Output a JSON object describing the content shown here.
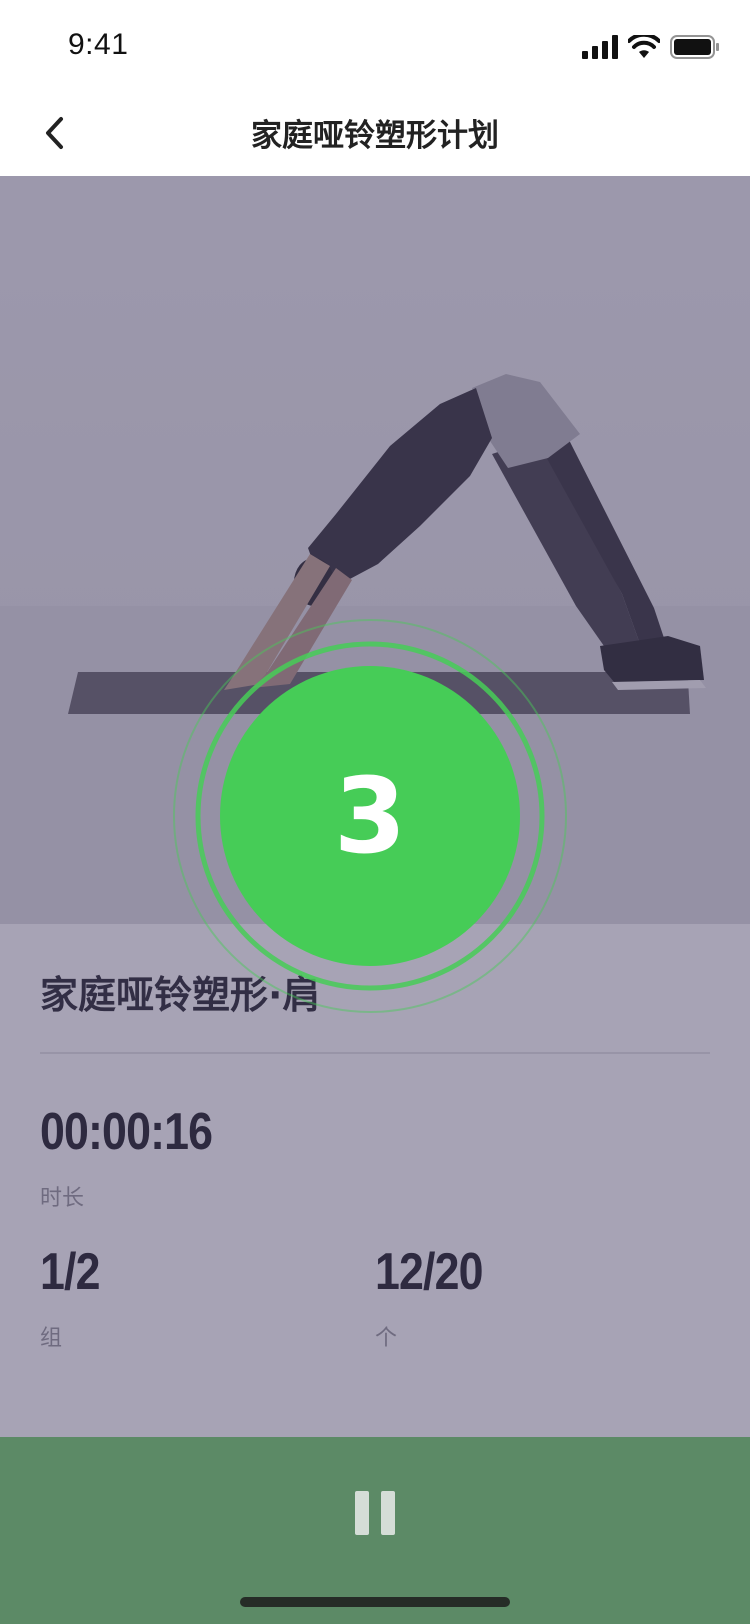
{
  "status_bar": {
    "time": "9:41"
  },
  "nav": {
    "title": "家庭哑铃塑形计划",
    "back_icon": "chevron-left-icon"
  },
  "workout": {
    "exercise_name": "家庭哑铃塑形·肩",
    "duration": {
      "value": "00:00:16",
      "label": "时长"
    },
    "sets": {
      "value": "1/2",
      "label": "组"
    },
    "reps": {
      "value": "12/20",
      "label": "个"
    }
  },
  "countdown": {
    "value": "3"
  },
  "controls": {
    "pause_icon": "pause-icon"
  },
  "colors": {
    "accent": "#46cc57",
    "bottom_bar": "#5c8a66"
  }
}
